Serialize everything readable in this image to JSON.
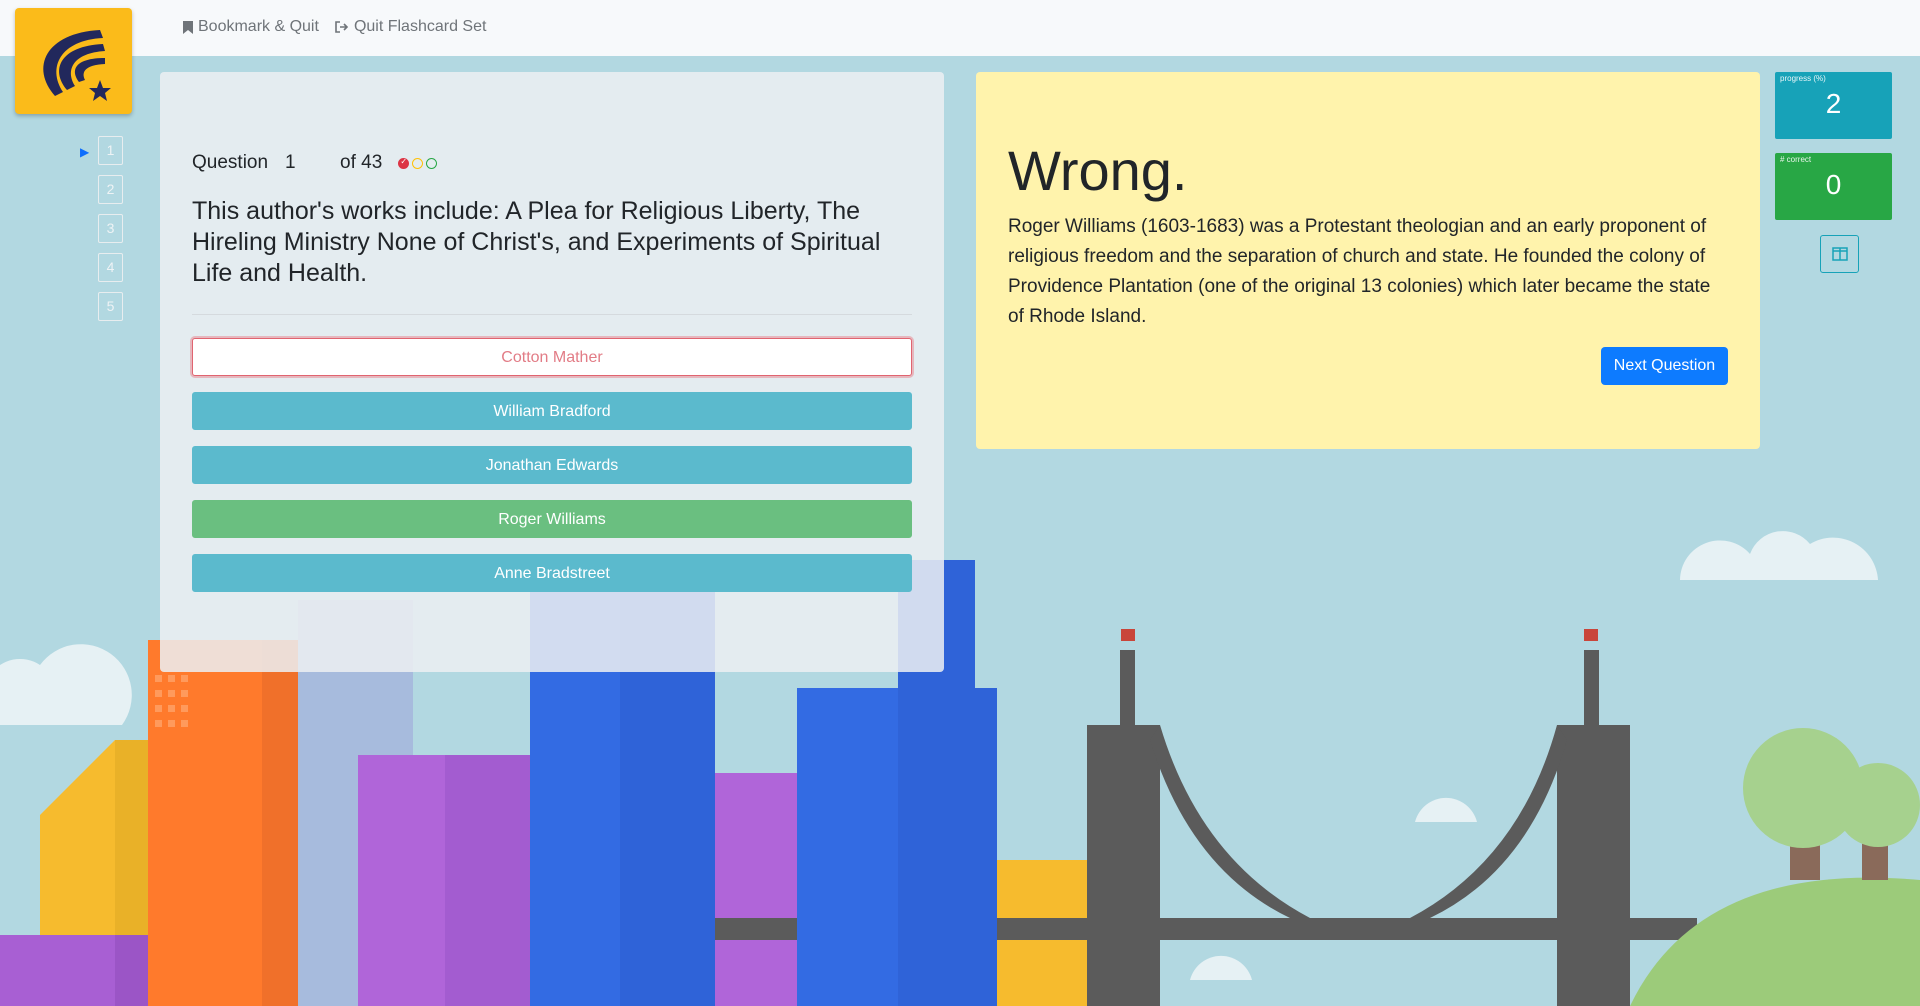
{
  "nav": {
    "bookmark_label": "Bookmark & Quit",
    "quit_label": "Quit Flashcard Set"
  },
  "sidebar": {
    "items": [
      {
        "label": "1"
      },
      {
        "label": "2"
      },
      {
        "label": "3"
      },
      {
        "label": "4"
      },
      {
        "label": "5"
      }
    ]
  },
  "question": {
    "label": "Question",
    "number": "1",
    "of_total": "of 43",
    "text": "This author's works include: A Plea for Religious Liberty, The Hireling Ministry None of Christ's, and Experiments of Spiritual Life and Health.",
    "answers": [
      {
        "label": "Cotton Mather",
        "state": "wrong"
      },
      {
        "label": "William Bradford",
        "state": "info"
      },
      {
        "label": "Jonathan Edwards",
        "state": "info"
      },
      {
        "label": "Roger Williams",
        "state": "success"
      },
      {
        "label": "Anne Bradstreet",
        "state": "info"
      }
    ]
  },
  "result": {
    "title": "Wrong.",
    "explanation": "Roger Williams (1603-1683) was a Protestant theologian and an early proponent of religious freedom and the separation of church and state. He founded the colony of Providence Plantation (one of the original 13 colonies) which later became the state of Rhode Island.",
    "next_label": "Next Question"
  },
  "stats": {
    "progress_label": "progress (%)",
    "progress_value": "2",
    "correct_label": "# correct",
    "correct_value": "0"
  },
  "colors": {
    "logo": "#fbbb1a",
    "result_bg": "#fff3ac",
    "info": "#5bbacd",
    "success": "#6abf80",
    "primary": "#0d7bff"
  }
}
